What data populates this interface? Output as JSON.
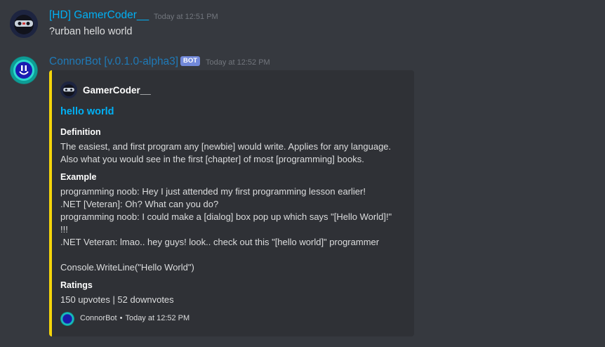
{
  "colors": {
    "background": "#36393f",
    "embed_background": "#2f3136",
    "embed_accent": "#f5d50a",
    "link": "#00b0f4",
    "bot_tag": "#7289da"
  },
  "messages": [
    {
      "author": "[HD] GamerCoder__",
      "author_color": "#00b0f4",
      "timestamp": "Today at 12:51 PM",
      "avatar_icon": "ninja-avatar",
      "content": "?urban hello world"
    },
    {
      "author": "ConnorBot [v.0.1.0-alpha3]",
      "author_color": "#1f7ab8",
      "bot_tag": "BOT",
      "timestamp": "Today at 12:52 PM",
      "avatar_icon": "bot-avatar",
      "embed": {
        "author_name": "GamerCoder__",
        "author_icon": "ninja-avatar",
        "title": "hello world",
        "fields": [
          {
            "name": "Definition",
            "lines": [
              "The easiest, and first program any [newbie] would write. Applies for any language.",
              "Also what you would see in the first [chapter] of most [programming] books."
            ]
          },
          {
            "name": "Example",
            "lines": [
              "programming noob: Hey I just attended my first programming lesson earlier!",
              ".NET [Veteran]: Oh? What can you do?",
              "programming noob: I could make a [dialog] box pop up which says \"[Hello World]!\"",
              "!!!",
              ".NET Veteran: lmao.. hey guys! look.. check out this \"[hello world]\" programmer",
              "",
              "Console.WriteLine(\"Hello World\")"
            ]
          },
          {
            "name": "Ratings",
            "lines": [
              "150 upvotes | 52 downvotes"
            ]
          }
        ],
        "footer": {
          "text": "ConnorBot",
          "separator": "•",
          "timestamp": "Today at 12:52 PM",
          "icon": "bot-avatar"
        }
      }
    }
  ]
}
